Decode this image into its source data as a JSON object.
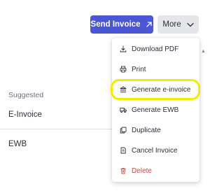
{
  "header": {
    "send_invoice_label": "Send Invoice",
    "more_label": "More"
  },
  "sidebar": {
    "section_label": "Suggested",
    "items": [
      {
        "label": "E-Invoice"
      },
      {
        "label": "EWB"
      }
    ]
  },
  "more_menu": {
    "items": [
      {
        "label": "Download PDF",
        "icon": "download-icon"
      },
      {
        "label": "Print",
        "icon": "printer-icon"
      },
      {
        "label": "Generate e-invoice",
        "icon": "bank-icon",
        "highlighted": true
      },
      {
        "label": "Generate EWB",
        "icon": "truck-icon"
      },
      {
        "label": "Duplicate",
        "icon": "copy-icon"
      },
      {
        "label": "Cancel Invoice",
        "icon": "document-icon"
      },
      {
        "label": "Delete",
        "icon": "trash-icon"
      }
    ]
  },
  "colors": {
    "primary": "#4b56d2",
    "secondary_button": "#e4e6ea",
    "delete": "#d9433a",
    "highlight": "#f2ec00"
  }
}
